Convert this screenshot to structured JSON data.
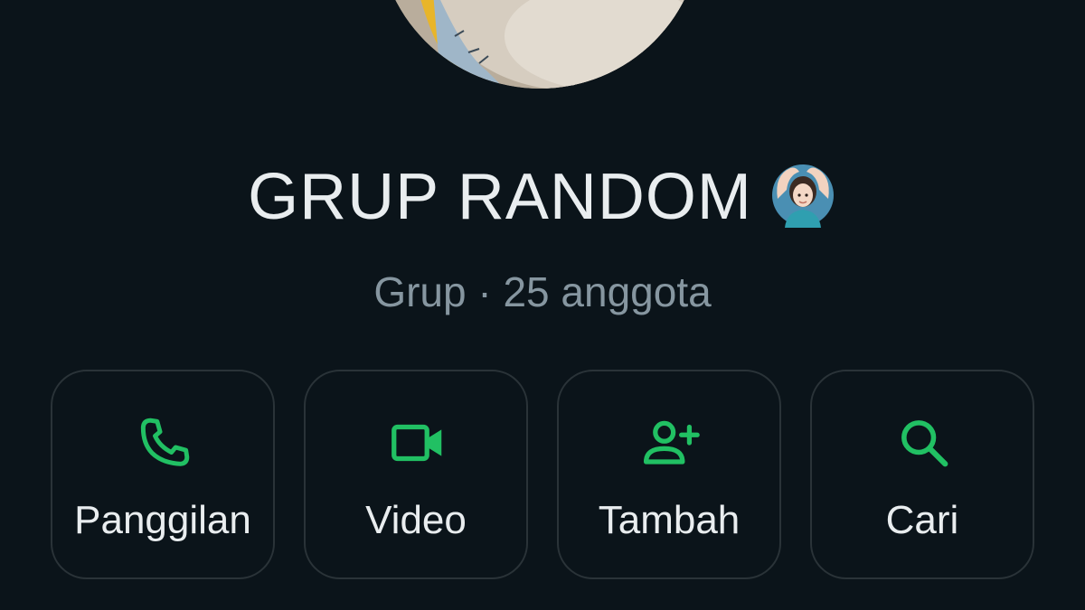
{
  "group": {
    "name": "GRUP RANDOM",
    "emoji": "🙆🏻‍♀️",
    "meta": "Grup · 25 anggota"
  },
  "actions": [
    {
      "label": "Panggilan",
      "icon": "phone-icon"
    },
    {
      "label": "Video",
      "icon": "video-camera-icon"
    },
    {
      "label": "Tambah",
      "icon": "add-person-icon"
    },
    {
      "label": "Cari",
      "icon": "search-icon"
    }
  ],
  "colors": {
    "background": "#0b141a",
    "accent": "#21c063",
    "text_primary": "#e9edef",
    "text_secondary": "#8696a0",
    "card_border": "#2a3338"
  }
}
